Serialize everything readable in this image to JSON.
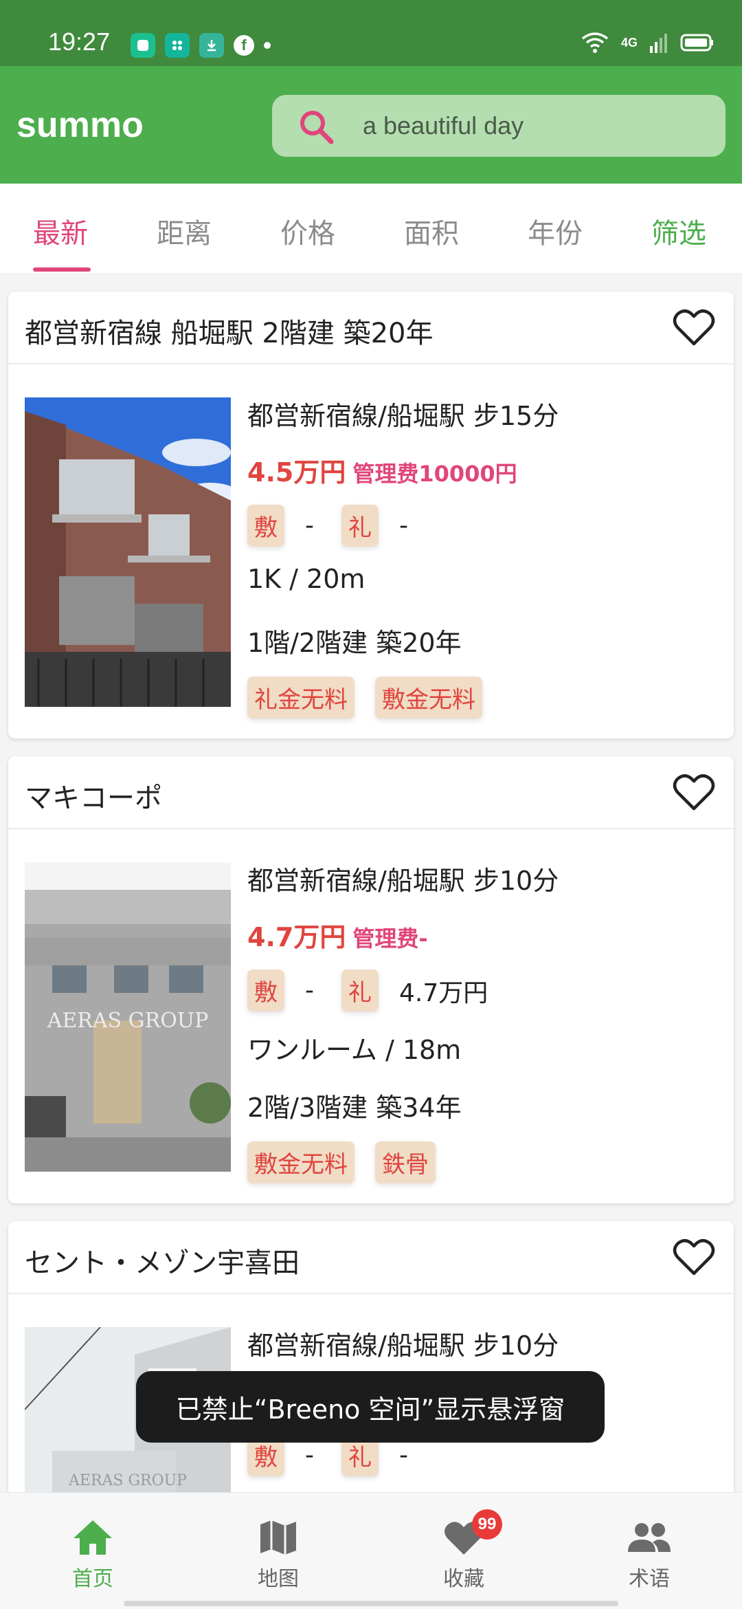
{
  "status_bar": {
    "time": "19:27",
    "network": "4G"
  },
  "app_bar": {
    "title": "summo",
    "search_text": "a beautiful day"
  },
  "tabs": [
    {
      "label": "最新",
      "active": true
    },
    {
      "label": "距离"
    },
    {
      "label": "价格"
    },
    {
      "label": "面积"
    },
    {
      "label": "年份"
    },
    {
      "label": "筛选"
    }
  ],
  "listings": [
    {
      "title": "都営新宿線 船堀駅 2階建 築20年",
      "station": "都営新宿線/船堀駅 步15分",
      "rent": "4.5万円",
      "management": "管理费10000円",
      "deposit_chip": "敷",
      "deposit_value": "-",
      "key_money_chip": "礼",
      "key_money_value": "-",
      "layout": "1K / 20m",
      "floor": "1階/2階建  築20年",
      "tags": [
        "礼金无料",
        "敷金无料"
      ]
    },
    {
      "title": "マキコーポ",
      "station": "都営新宿線/船堀駅 步10分",
      "rent": "4.7万円",
      "management": "管理费-",
      "deposit_chip": "敷",
      "deposit_value": "-",
      "key_money_chip": "礼",
      "key_money_value": "4.7万円",
      "layout": "ワンルーム / 18m",
      "floor": "2階/3階建  築34年",
      "tags": [
        "敷金无料",
        "鉄骨"
      ],
      "watermark": "AERAS GROUP"
    },
    {
      "title": "セント・メゾン宇喜田",
      "station": "都営新宿線/船堀駅 步10分",
      "deposit_chip": "敷",
      "deposit_value": "-",
      "key_money_chip": "礼",
      "key_money_value": "-",
      "watermark": "AERAS GROUP"
    }
  ],
  "toast": "已禁止“Breeno 空间”显示悬浮窗",
  "bottom_nav": [
    {
      "label": "首页",
      "icon": "home-icon",
      "active": true
    },
    {
      "label": "地图",
      "icon": "map-icon"
    },
    {
      "label": "收藏",
      "icon": "heart-icon",
      "badge": "99"
    },
    {
      "label": "术语",
      "icon": "people-icon"
    }
  ],
  "colors": {
    "primary_green": "#4cae4c",
    "status_green": "#3f8a3c",
    "accent_pink": "#e0457b",
    "price_red": "#e0453f",
    "chip_bg": "#f1dcc6"
  }
}
